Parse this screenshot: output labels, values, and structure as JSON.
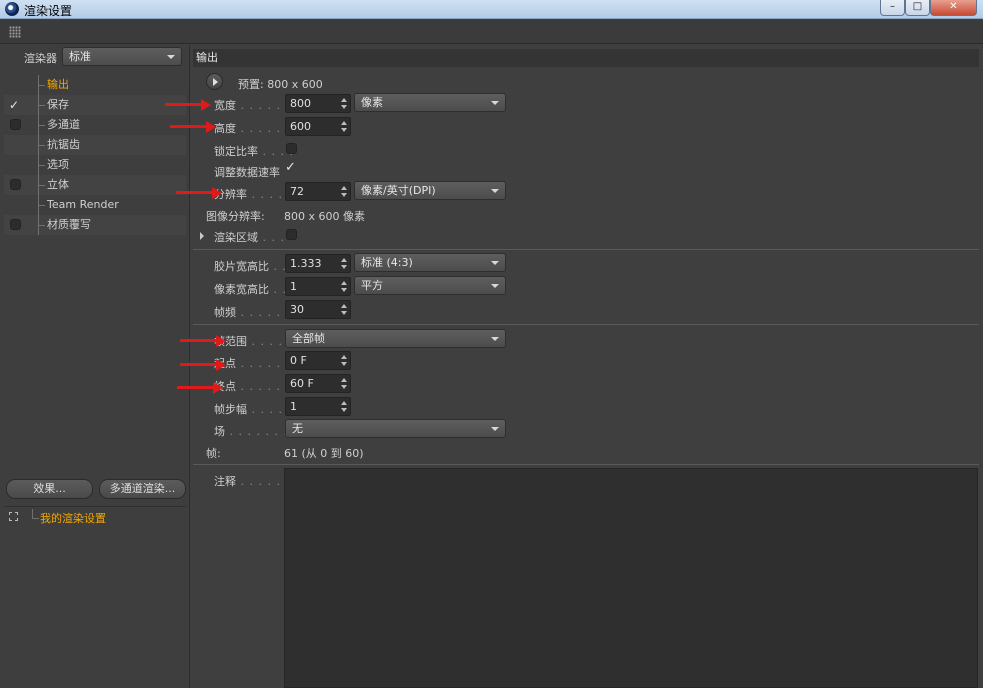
{
  "window": {
    "title": "渲染设置",
    "minimize_glyph": "–",
    "maximize_glyph": "□",
    "close_glyph": "✕"
  },
  "left": {
    "renderer_label": "渲染器",
    "renderer_value": "标准",
    "tree": [
      {
        "label": "输出",
        "checked": null,
        "selected": true
      },
      {
        "label": "保存",
        "checked": true
      },
      {
        "label": "多通道",
        "checked": false
      },
      {
        "label": "抗锯齿",
        "checked": null
      },
      {
        "label": "选项",
        "checked": null
      },
      {
        "label": "立体",
        "checked": false
      },
      {
        "label": "Team Render",
        "checked": null
      },
      {
        "label": "材质覆写",
        "checked": false
      }
    ],
    "effects_button": "效果...",
    "multipass_button": "多通道渲染...",
    "preset_label": "我的渲染设置"
  },
  "output": {
    "header": "输出",
    "preset_text": "预置: 800 x 600",
    "width_label": "宽度",
    "width_value": "800",
    "unit_value": "像素",
    "height_label": "高度",
    "height_value": "600",
    "lock_ratio_label": "锁定比率",
    "adjust_rate_label": "调整数据速率",
    "resolution_label": "分辨率",
    "resolution_value": "72",
    "resolution_unit": "像素/英寸(DPI)",
    "image_resolution_label": "图像分辨率:",
    "image_resolution_value": "800 x 600 像素",
    "render_region_label": "渲染区域",
    "film_aspect_label": "胶片宽高比",
    "film_aspect_value": "1.333",
    "film_aspect_preset": "标准 (4:3)",
    "pixel_aspect_label": "像素宽高比",
    "pixel_aspect_value": "1",
    "pixel_aspect_preset": "平方",
    "fps_label": "帧频",
    "fps_value": "30",
    "frame_range_label": "帧范围",
    "frame_range_value": "全部帧",
    "start_label": "起点",
    "start_value": "0 F",
    "end_label": "终点",
    "end_value": "60 F",
    "frame_step_label": "帧步幅",
    "frame_step_value": "1",
    "field_label": "场",
    "field_value": "无",
    "frames_label": "帧:",
    "frames_value": "61 (从 0 到 60)",
    "notes_label": "注释"
  },
  "colors": {
    "annotation_arrow": "#e11919",
    "selected_text": "#f2a800"
  }
}
